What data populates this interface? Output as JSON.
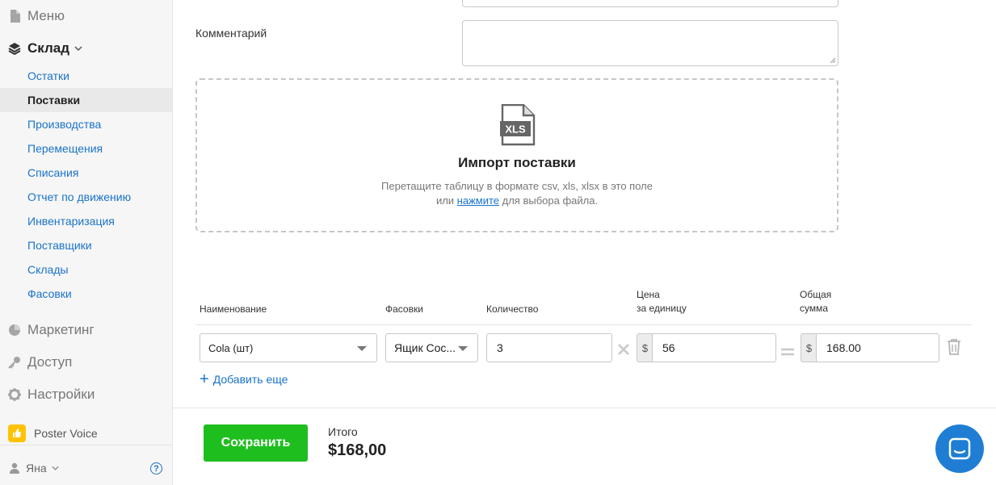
{
  "sidebar": {
    "menu_label": "Меню",
    "warehouse_label": "Склад",
    "items": [
      {
        "label": "Остатки"
      },
      {
        "label": "Поставки"
      },
      {
        "label": "Производства"
      },
      {
        "label": "Перемещения"
      },
      {
        "label": "Списания"
      },
      {
        "label": "Отчет по движению"
      },
      {
        "label": "Инвентаризация"
      },
      {
        "label": "Поставщики"
      },
      {
        "label": "Склады"
      },
      {
        "label": "Фасовки"
      }
    ],
    "active_item": "Поставки",
    "marketing_label": "Маркетинг",
    "access_label": "Доступ",
    "settings_label": "Настройки",
    "voice_label": "Poster Voice",
    "user_name": "Яна",
    "help_glyph": "?"
  },
  "form": {
    "comment_label": "Комментарий",
    "comment_value": ""
  },
  "import": {
    "icon_text": "XLS",
    "title": "Импорт поставки",
    "line1": "Перетащите таблицу в формате csv, xls, xlsx в это поле",
    "line2_prefix": "или ",
    "link": "нажмите",
    "line2_suffix": " для выбора файла."
  },
  "table": {
    "headers": {
      "name": "Наименование",
      "packaging": "Фасовки",
      "quantity": "Количество",
      "unit_price_1": "Цена",
      "unit_price_2": "за единицу",
      "total_1": "Общая",
      "total_2": "сумма"
    },
    "row": {
      "name": "Cola (шт)",
      "packaging": "Ящик Coc...",
      "quantity": "3",
      "currency": "$",
      "unit_price": "56",
      "total": "168.00"
    },
    "add_more": "Добавить еще"
  },
  "footer": {
    "save_label": "Сохранить",
    "total_label": "Итого",
    "total_value": "$168,00"
  },
  "colors": {
    "accent": "#1a73c9",
    "save_button": "#1fbe1f",
    "chat_button": "#1f7ed4",
    "voice_badge": "#ffc200"
  }
}
